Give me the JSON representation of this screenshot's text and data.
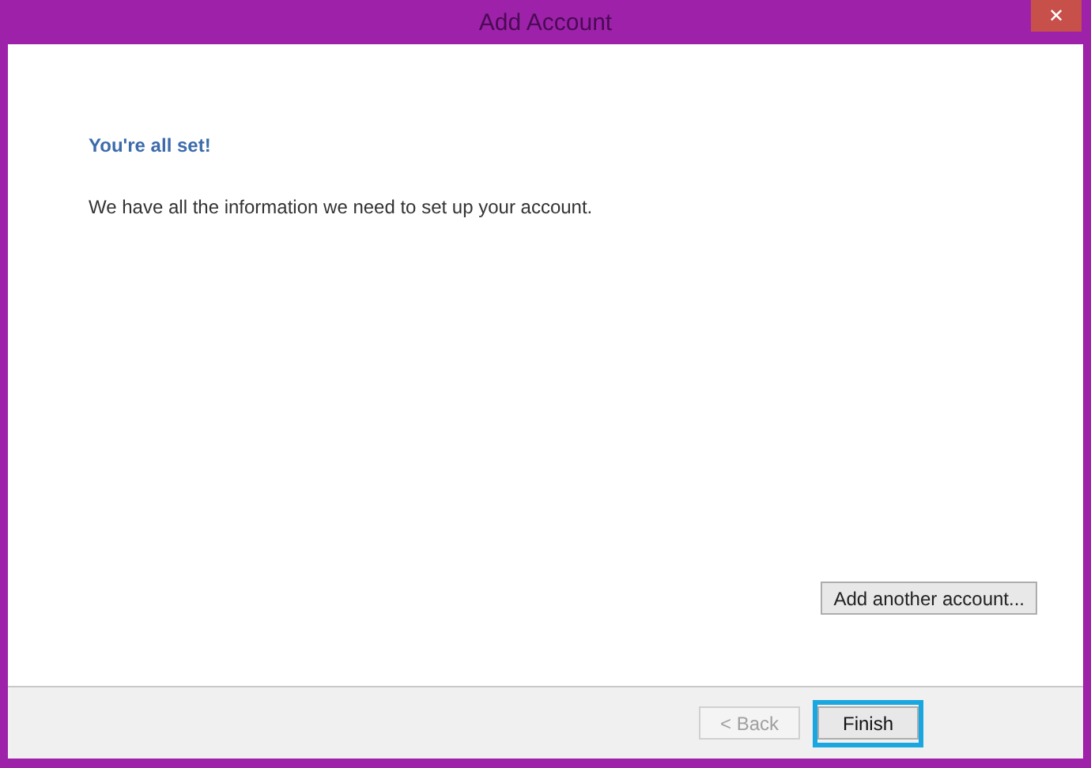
{
  "window": {
    "title": "Add Account",
    "close": "✕"
  },
  "heading": "You're all set!",
  "message": "We have all the information we need to set up your account.",
  "add_another": "Add another account...",
  "buttons": [
    {
      "label": "< Back",
      "disabled": true,
      "focused": false
    },
    {
      "label": "Finish",
      "disabled": false,
      "focused": true
    }
  ]
}
